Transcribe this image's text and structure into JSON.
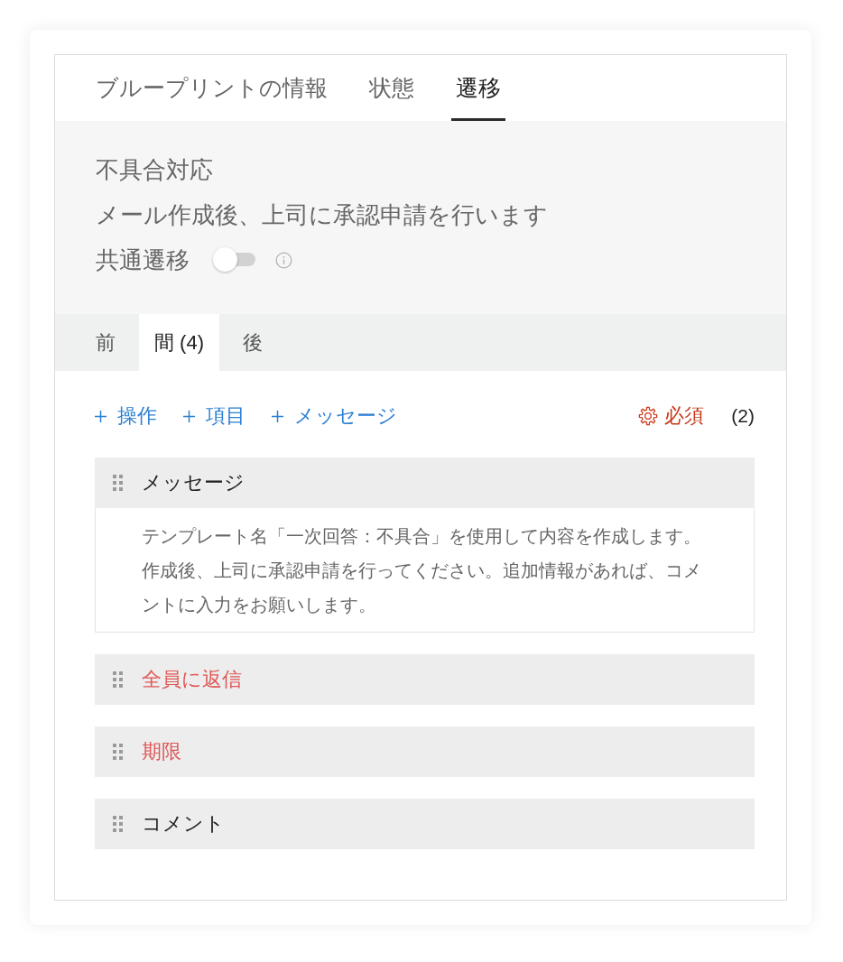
{
  "tabs": [
    {
      "label": "ブループリントの情報",
      "selected": false
    },
    {
      "label": "状態",
      "selected": false
    },
    {
      "label": "遷移",
      "selected": true
    }
  ],
  "transition": {
    "name": "不具合対応",
    "description": "メール作成後、上司に承認申請を行います",
    "common_transition": {
      "label": "共通遷移",
      "on": false
    }
  },
  "sub_tabs": [
    {
      "label": "前",
      "selected": false
    },
    {
      "label": "間 (4)",
      "selected": true
    },
    {
      "label": "後",
      "selected": false
    }
  ],
  "toolbar": {
    "add_buttons": [
      "操作",
      "項目",
      "メッセージ"
    ],
    "required": {
      "label": "必須",
      "count": "(2)"
    }
  },
  "items": [
    {
      "title": "メッセージ",
      "required": false,
      "body": "テンプレート名「一次回答：不具合」を使用して内容を作成します。作成後、上司に承認申請を行ってください。追加情報があれば、コメントに入力をお願いします。"
    },
    {
      "title": "全員に返信",
      "required": true
    },
    {
      "title": "期限",
      "required": true
    },
    {
      "title": "コメント",
      "required": false
    }
  ]
}
